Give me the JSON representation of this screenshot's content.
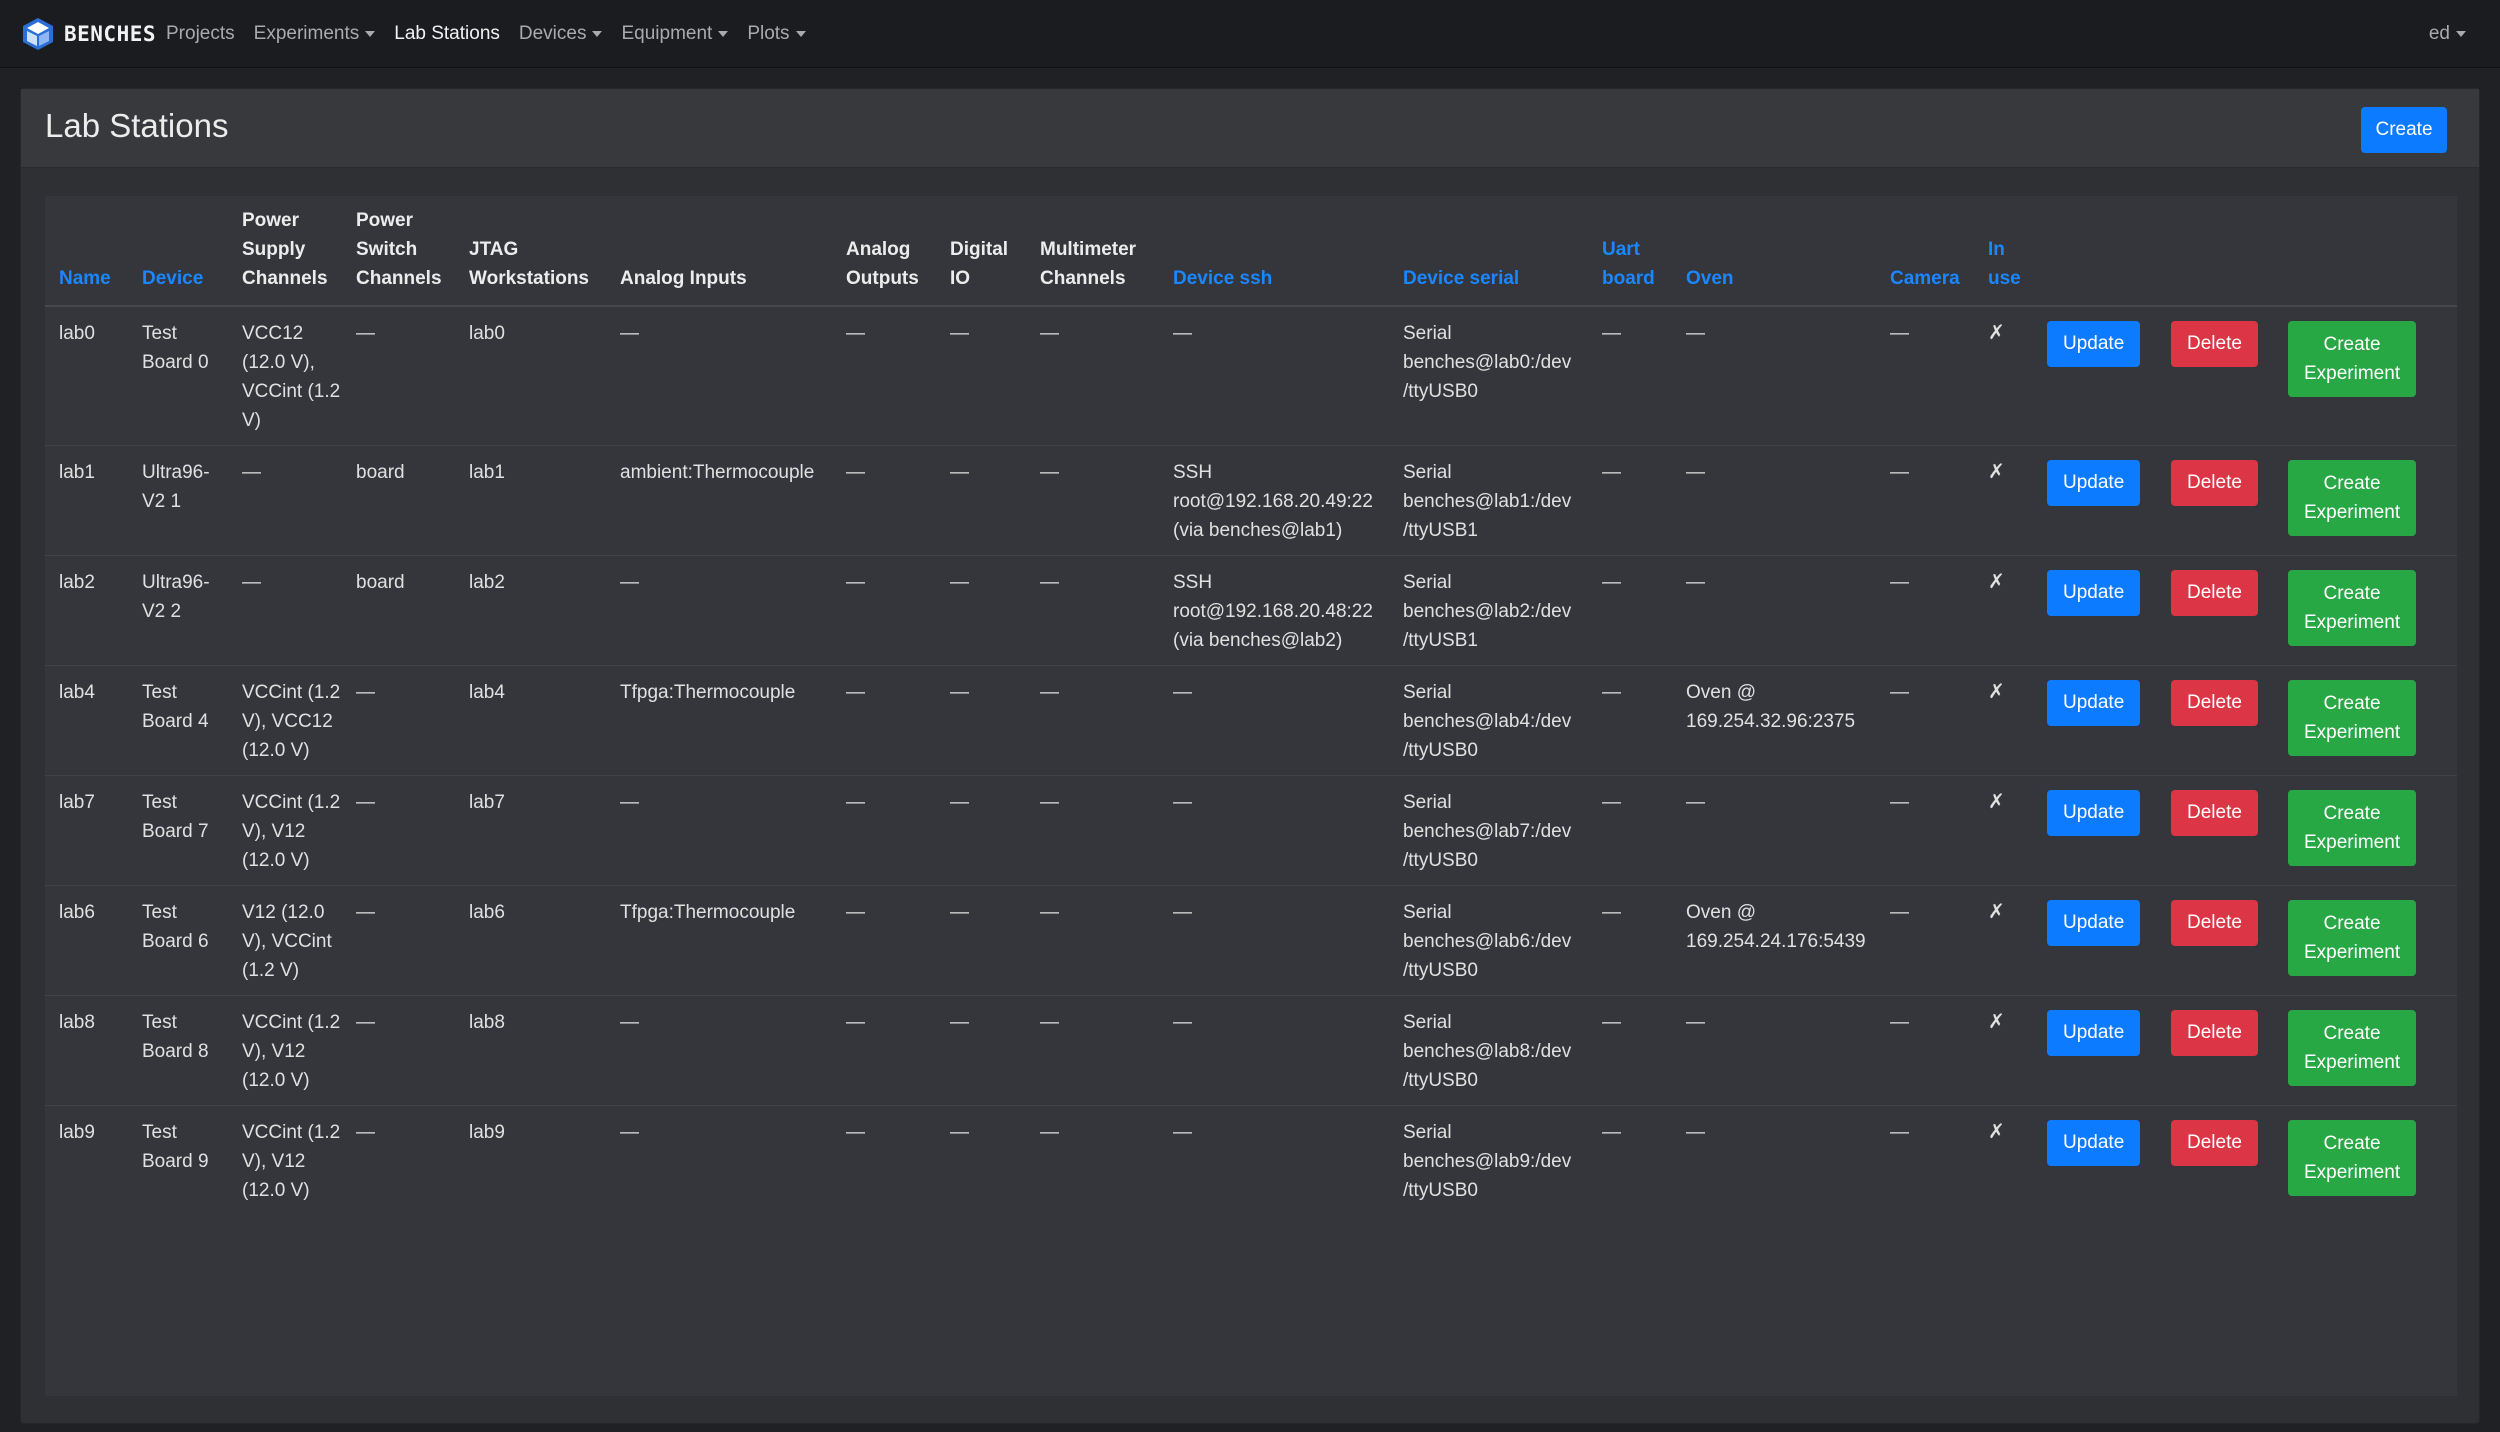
{
  "brand": "BENCHES",
  "nav": {
    "items": [
      {
        "label": "Projects",
        "dropdown": false,
        "active": false
      },
      {
        "label": "Experiments",
        "dropdown": true,
        "active": false
      },
      {
        "label": "Lab Stations",
        "dropdown": false,
        "active": true
      },
      {
        "label": "Devices",
        "dropdown": true,
        "active": false
      },
      {
        "label": "Equipment",
        "dropdown": true,
        "active": false
      },
      {
        "label": "Plots",
        "dropdown": true,
        "active": false
      }
    ],
    "user": "ed"
  },
  "page": {
    "title": "Lab Stations",
    "create_label": "Create"
  },
  "table": {
    "columns": [
      {
        "label": "Name",
        "sortable": true
      },
      {
        "label": "Device",
        "sortable": true
      },
      {
        "label": "Power Supply Channels",
        "sortable": false
      },
      {
        "label": "Power Switch Channels",
        "sortable": false
      },
      {
        "label": "JTAG Workstations",
        "sortable": false
      },
      {
        "label": "Analog Inputs",
        "sortable": false
      },
      {
        "label": "Analog Outputs",
        "sortable": false
      },
      {
        "label": "Digital IO",
        "sortable": false
      },
      {
        "label": "Multimeter Channels",
        "sortable": false
      },
      {
        "label": "Device ssh",
        "sortable": true
      },
      {
        "label": "Device serial",
        "sortable": true
      },
      {
        "label": "Uart board",
        "sortable": true
      },
      {
        "label": "Oven",
        "sortable": true
      },
      {
        "label": "Camera",
        "sortable": true
      },
      {
        "label": "In use",
        "sortable": true
      }
    ],
    "actions": {
      "update": "Update",
      "delete": "Delete",
      "create_experiment": "Create Experiment"
    },
    "rows": [
      {
        "name": "lab0",
        "device": "Test Board 0",
        "power_supply": "VCC12 (12.0 V), VCCint (1.2 V)",
        "power_switch": "—",
        "jtag": "lab0",
        "analog_in": "—",
        "analog_out": "—",
        "digital_io": "—",
        "multimeter": "—",
        "ssh": "—",
        "serial": "Serial benches@lab0:/dev /ttyUSB0",
        "uart": "—",
        "oven": "—",
        "camera": "—",
        "in_use": "✗"
      },
      {
        "name": "lab1",
        "device": "Ultra96-V2 1",
        "power_supply": "—",
        "power_switch": "board",
        "jtag": "lab1",
        "analog_in": "ambient:Thermocouple",
        "analog_out": "—",
        "digital_io": "—",
        "multimeter": "—",
        "ssh": "SSH root@192.168.20.49:22 (via benches@lab1)",
        "serial": "Serial benches@lab1:/dev /ttyUSB1",
        "uart": "—",
        "oven": "—",
        "camera": "—",
        "in_use": "✗"
      },
      {
        "name": "lab2",
        "device": "Ultra96-V2 2",
        "power_supply": "—",
        "power_switch": "board",
        "jtag": "lab2",
        "analog_in": "—",
        "analog_out": "—",
        "digital_io": "—",
        "multimeter": "—",
        "ssh": "SSH root@192.168.20.48:22 (via benches@lab2)",
        "serial": "Serial benches@lab2:/dev /ttyUSB1",
        "uart": "—",
        "oven": "—",
        "camera": "—",
        "in_use": "✗"
      },
      {
        "name": "lab4",
        "device": "Test Board 4",
        "power_supply": "VCCint (1.2 V), VCC12 (12.0 V)",
        "power_switch": "—",
        "jtag": "lab4",
        "analog_in": "Tfpga:Thermocouple",
        "analog_out": "—",
        "digital_io": "—",
        "multimeter": "—",
        "ssh": "—",
        "serial": "Serial benches@lab4:/dev /ttyUSB0",
        "uart": "—",
        "oven": "Oven @ 169.254.32.96:2375",
        "camera": "—",
        "in_use": "✗"
      },
      {
        "name": "lab7",
        "device": "Test Board 7",
        "power_supply": "VCCint (1.2 V), V12 (12.0 V)",
        "power_switch": "—",
        "jtag": "lab7",
        "analog_in": "—",
        "analog_out": "—",
        "digital_io": "—",
        "multimeter": "—",
        "ssh": "—",
        "serial": "Serial benches@lab7:/dev /ttyUSB0",
        "uart": "—",
        "oven": "—",
        "camera": "—",
        "in_use": "✗"
      },
      {
        "name": "lab6",
        "device": "Test Board 6",
        "power_supply": "V12 (12.0 V), VCCint (1.2 V)",
        "power_switch": "—",
        "jtag": "lab6",
        "analog_in": "Tfpga:Thermocouple",
        "analog_out": "—",
        "digital_io": "—",
        "multimeter": "—",
        "ssh": "—",
        "serial": "Serial benches@lab6:/dev /ttyUSB0",
        "uart": "—",
        "oven": "Oven @ 169.254.24.176:5439",
        "camera": "—",
        "in_use": "✗"
      },
      {
        "name": "lab8",
        "device": "Test Board 8",
        "power_supply": "VCCint (1.2 V), V12 (12.0 V)",
        "power_switch": "—",
        "jtag": "lab8",
        "analog_in": "—",
        "analog_out": "—",
        "digital_io": "—",
        "multimeter": "—",
        "ssh": "—",
        "serial": "Serial benches@lab8:/dev /ttyUSB0",
        "uart": "—",
        "oven": "—",
        "camera": "—",
        "in_use": "✗"
      },
      {
        "name": "lab9",
        "device": "Test Board 9",
        "power_supply": "VCCint (1.2 V), V12 (12.0 V)",
        "power_switch": "—",
        "jtag": "lab9",
        "analog_in": "—",
        "analog_out": "—",
        "digital_io": "—",
        "multimeter": "—",
        "ssh": "—",
        "serial": "Serial benches@lab9:/dev /ttyUSB0",
        "uart": "—",
        "oven": "—",
        "camera": "—",
        "in_use": "✗"
      }
    ]
  },
  "colors": {
    "background": "#202124",
    "navbar": "#1b1c1f",
    "card": "#2f3034",
    "table": "#34363b",
    "link_blue": "#1a86ff",
    "primary": "#0d7bff",
    "danger": "#dc3545",
    "success": "#28a745"
  }
}
